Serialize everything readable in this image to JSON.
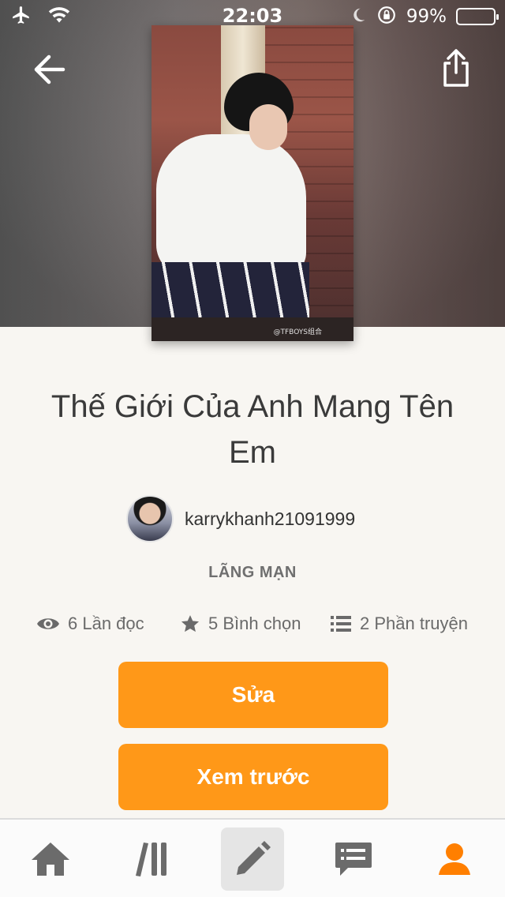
{
  "status_bar": {
    "time": "22:03",
    "battery_percent": "99%",
    "battery_level": 0.99,
    "battery_color": "#ffc400"
  },
  "header": {
    "back_icon": "arrow-left-icon",
    "share_icon": "share-icon"
  },
  "cover": {
    "watermark": "@TFBOYS组合"
  },
  "story": {
    "title": "Thế Giới Của Anh Mang Tên Em",
    "author": "karrykhanh21091999",
    "genre": "LÃNG MẠN",
    "reads": "6 Lần đọc",
    "votes": "5 Bình chọn",
    "parts": "2 Phần truyện"
  },
  "actions": {
    "edit_label": "Sửa",
    "preview_label": "Xem trước",
    "accent_color": "#ff9818"
  },
  "bottom_nav": {
    "items": [
      {
        "name": "home",
        "icon": "home-icon"
      },
      {
        "name": "library",
        "icon": "library-icon"
      },
      {
        "name": "write",
        "icon": "pencil-icon",
        "active": true
      },
      {
        "name": "messages",
        "icon": "chat-icon"
      },
      {
        "name": "profile",
        "icon": "person-icon",
        "selected_color": "#ff7f00"
      }
    ]
  }
}
